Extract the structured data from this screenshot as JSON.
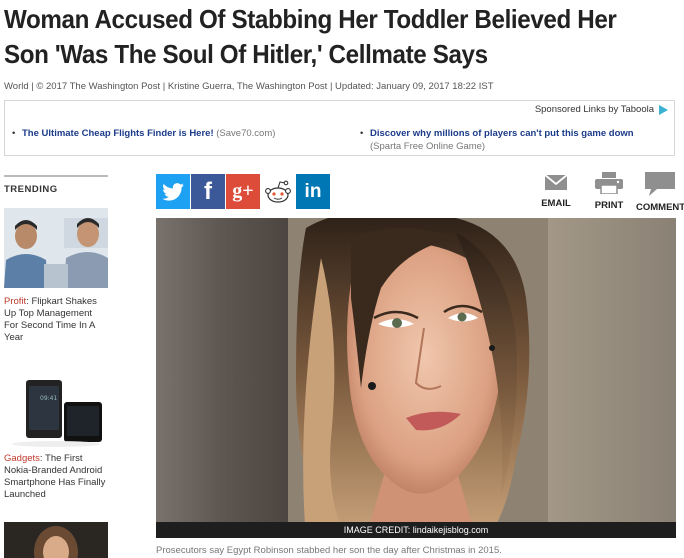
{
  "article": {
    "headline_line1": "Woman Accused Of Stabbing Her Toddler Believed Her",
    "headline_line2": "Son 'Was The Soul Of Hitler,' Cellmate Says",
    "byline": "World | © 2017 The Washington Post | Kristine Guerra, The Washington Post | Updated: January 09, 2017 18:22 IST"
  },
  "sponsored": {
    "label": "Sponsored Links by Taboola",
    "items": [
      {
        "title": "The Ultimate Cheap Flights Finder is Here!",
        "source": "(Save70.com)"
      },
      {
        "title": "Discover why millions of players can't put this game down",
        "source": "(Sparta Free Online Game)"
      }
    ]
  },
  "sidebar": {
    "heading": "TRENDING",
    "items": [
      {
        "category": "Profit",
        "text": ": Flipkart Shakes Up Top Management For Second Time In A Year"
      },
      {
        "category": "Gadgets",
        "text": ": The First Nokia-Branded Android Smartphone Has Finally Launched"
      }
    ]
  },
  "share": {
    "twitter_icon": "twitter-icon",
    "facebook_icon": "facebook-icon",
    "googleplus_label": "g+",
    "reddit_icon": "reddit-icon",
    "linkedin_label": "in"
  },
  "tools": {
    "email_label": "EMAIL",
    "print_label": "PRINT",
    "comment_label": "COMMENT"
  },
  "photo": {
    "credit": "IMAGE CREDIT: lindaikejisblog.com",
    "caption": "Prosecutors say Egypt Robinson stabbed her son the day after Christmas in 2015."
  },
  "colors": {
    "twitter": "#1da1f2",
    "facebook": "#3b5998",
    "googleplus": "#dd4b39",
    "linkedin": "#0077b5",
    "link": "#1b3b8a",
    "category": "#c0392b"
  }
}
